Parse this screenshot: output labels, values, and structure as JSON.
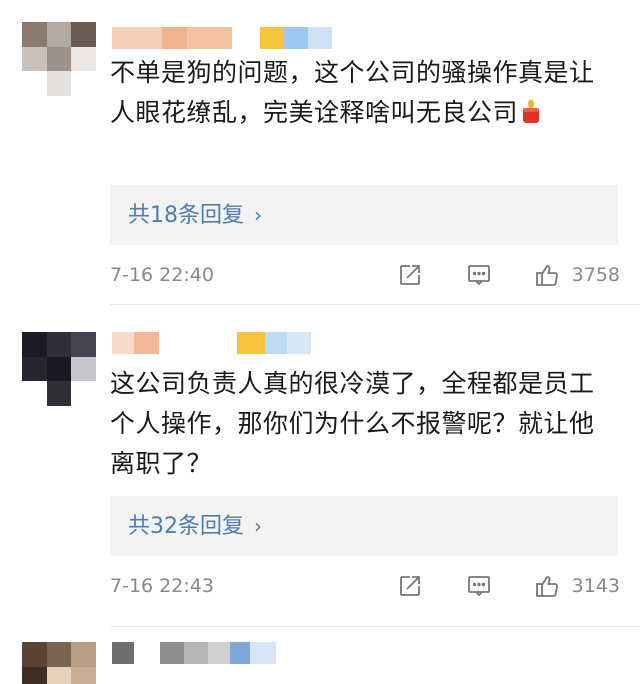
{
  "comments": [
    {
      "text": "不单是狗的问题，这个公司的骚操作真是让人眼花缭乱，完美诠释啥叫无良公司",
      "emoji": "red-candle-emoji",
      "replies_label": "共18条回复",
      "replies_chevron": "›",
      "timestamp": "7-16 22:40",
      "likes": "3758"
    },
    {
      "text": "这公司负责人真的很冷漠了，全程都是员工个人操作，那你们为什么不报警呢？就让他离职了？",
      "replies_label": "共32条回复",
      "replies_chevron": "›",
      "timestamp": "7-16 22:43",
      "likes": "3143"
    },
    {
      "text": ""
    }
  ],
  "icons": {
    "share": "share-icon",
    "comment": "comment-icon",
    "like": "thumbs-up-icon"
  },
  "colors": {
    "reply_link": "#4f7cae",
    "meta_gray": "#888888",
    "reply_bg": "#f3f3f3"
  }
}
